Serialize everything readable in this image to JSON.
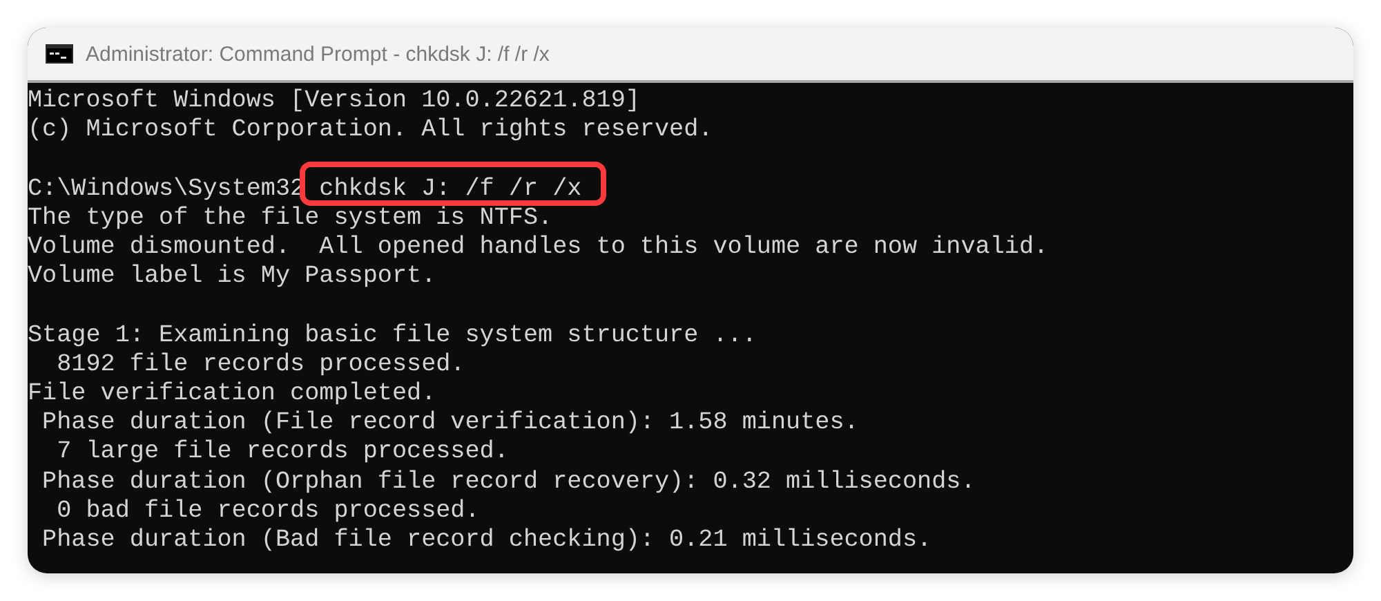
{
  "window": {
    "title": "Administrator: Command Prompt - chkdsk J: /f /r /x"
  },
  "console": {
    "blocks": [
      {
        "lines": [
          {
            "kind": "output",
            "text": "Microsoft Windows [Version 10.0.22621.819]"
          },
          {
            "kind": "output",
            "text": "(c) Microsoft Corporation. All rights reserved."
          }
        ]
      },
      {
        "lines": [
          {
            "kind": "command",
            "prompt": "C:\\Windows\\System32",
            "command": "chkdsk J: /f /r /x",
            "highlighted": true
          },
          {
            "kind": "output",
            "text": "The type of the file system is NTFS."
          },
          {
            "kind": "output",
            "text": "Volume dismounted.  All opened handles to this volume are now invalid."
          },
          {
            "kind": "output",
            "text": "Volume label is My Passport."
          }
        ]
      },
      {
        "lines": [
          {
            "kind": "output",
            "text": "Stage 1: Examining basic file system structure ..."
          },
          {
            "kind": "output",
            "text": "  8192 file records processed."
          },
          {
            "kind": "output",
            "text": "File verification completed."
          },
          {
            "kind": "output",
            "text": " Phase duration (File record verification): 1.58 minutes."
          },
          {
            "kind": "output",
            "text": "  7 large file records processed."
          },
          {
            "kind": "output",
            "text": " Phase duration (Orphan file record recovery): 0.32 milliseconds."
          },
          {
            "kind": "output",
            "text": "  0 bad file records processed."
          },
          {
            "kind": "output",
            "text": " Phase duration (Bad file record checking): 0.21 milliseconds."
          }
        ]
      }
    ]
  }
}
